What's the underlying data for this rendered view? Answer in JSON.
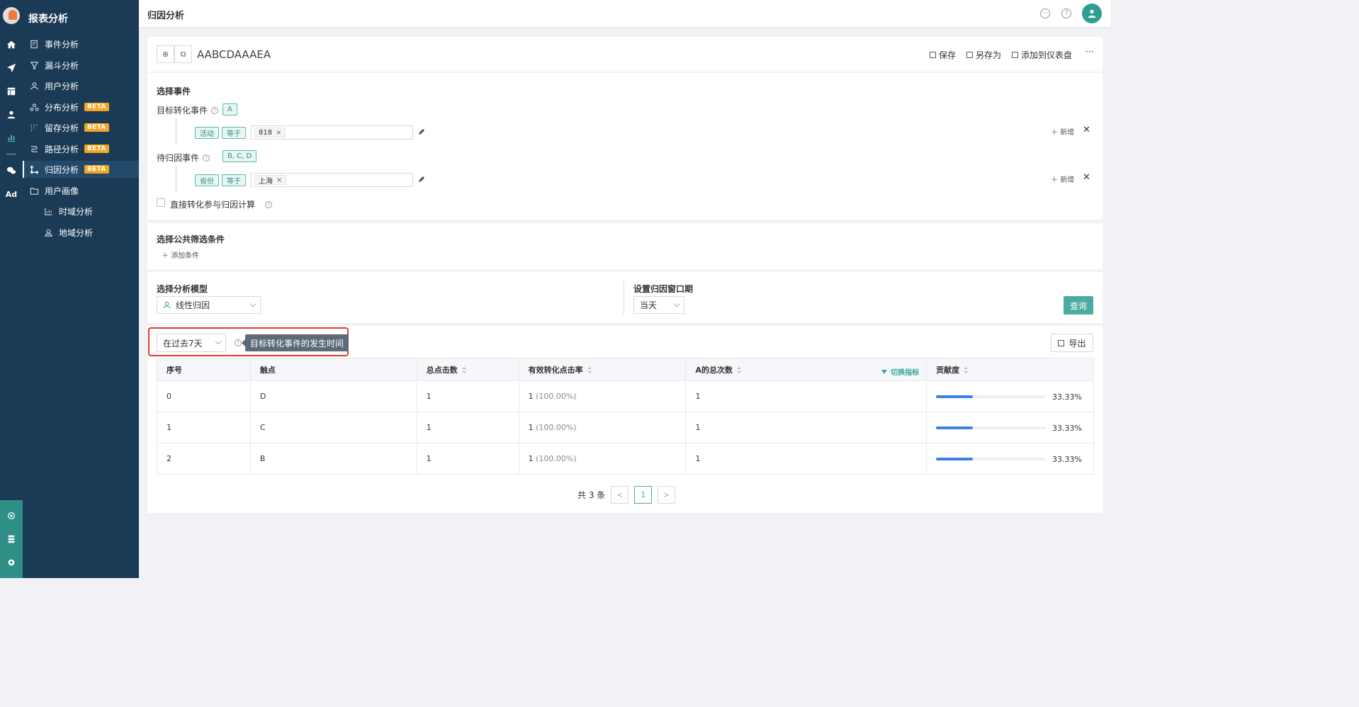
{
  "sidebar": {
    "title": "报表分析",
    "items": [
      {
        "label": "事件分析",
        "icon": "event-icon",
        "beta": ""
      },
      {
        "label": "漏斗分析",
        "icon": "funnel-icon",
        "beta": ""
      },
      {
        "label": "用户分析",
        "icon": "user-icon",
        "beta": ""
      },
      {
        "label": "分布分析",
        "icon": "distribution-icon",
        "beta": "BETA"
      },
      {
        "label": "留存分析",
        "icon": "retention-icon",
        "beta": "BETA"
      },
      {
        "label": "路径分析",
        "icon": "path-icon",
        "beta": "BETA"
      },
      {
        "label": "归因分析",
        "icon": "attribution-icon",
        "beta": "BETA"
      },
      {
        "label": "用户画像",
        "icon": "folder-icon",
        "beta": ""
      },
      {
        "label": "时域分析",
        "icon": "chart-icon",
        "beta": ""
      },
      {
        "label": "地域分析",
        "icon": "map-user-icon",
        "beta": ""
      }
    ]
  },
  "rail": {
    "ad_label": "Ad"
  },
  "topbar": {
    "title": "归因分析"
  },
  "report": {
    "name": "AABCDAAAEA",
    "save": "保存",
    "save_as": "另存为",
    "add_dashboard": "添加到仪表盘",
    "more": "···"
  },
  "events": {
    "section_title": "选择事件",
    "target_label": "目标转化事件",
    "target_tag": "A",
    "target_filter": {
      "field": "活动",
      "op": "等于",
      "value": "818"
    },
    "pending_label": "待归因事件",
    "pending_tag": "B, C, D",
    "pending_filter": {
      "field": "省份",
      "op": "等于",
      "value": "上海"
    },
    "add_label": "新增",
    "close": "✕",
    "direct_label": "直接转化参与归因计算"
  },
  "filters": {
    "section_title": "选择公共筛选条件",
    "add_label": "添加条件"
  },
  "model": {
    "section_title": "选择分析模型",
    "model_value": "线性归因",
    "window_title": "设置归因窗口期",
    "window_value": "当天",
    "query": "查询"
  },
  "result": {
    "range_value": "在过去7天",
    "tooltip": "目标转化事件的发生时间",
    "export": "导出",
    "switch_metric": "切换指标",
    "headers": [
      "序号",
      "触点",
      "总点击数",
      "有效转化点击率",
      "A的总次数",
      "贡献度"
    ],
    "rows": [
      {
        "index": "0",
        "touch": "D",
        "clicks": "1",
        "rate": "1",
        "rate_pct": "(100.00%)",
        "total": "1",
        "contrib": "33.33%",
        "contrib_value": 0.3333
      },
      {
        "index": "1",
        "touch": "C",
        "clicks": "1",
        "rate": "1",
        "rate_pct": "(100.00%)",
        "total": "1",
        "contrib": "33.33%",
        "contrib_value": 0.3333
      },
      {
        "index": "2",
        "touch": "B",
        "clicks": "1",
        "rate": "1",
        "rate_pct": "(100.00%)",
        "total": "1",
        "contrib": "33.33%",
        "contrib_value": 0.3333
      }
    ],
    "total_text": "共 3 条",
    "page": "1",
    "prev": "<",
    "next": ">"
  }
}
